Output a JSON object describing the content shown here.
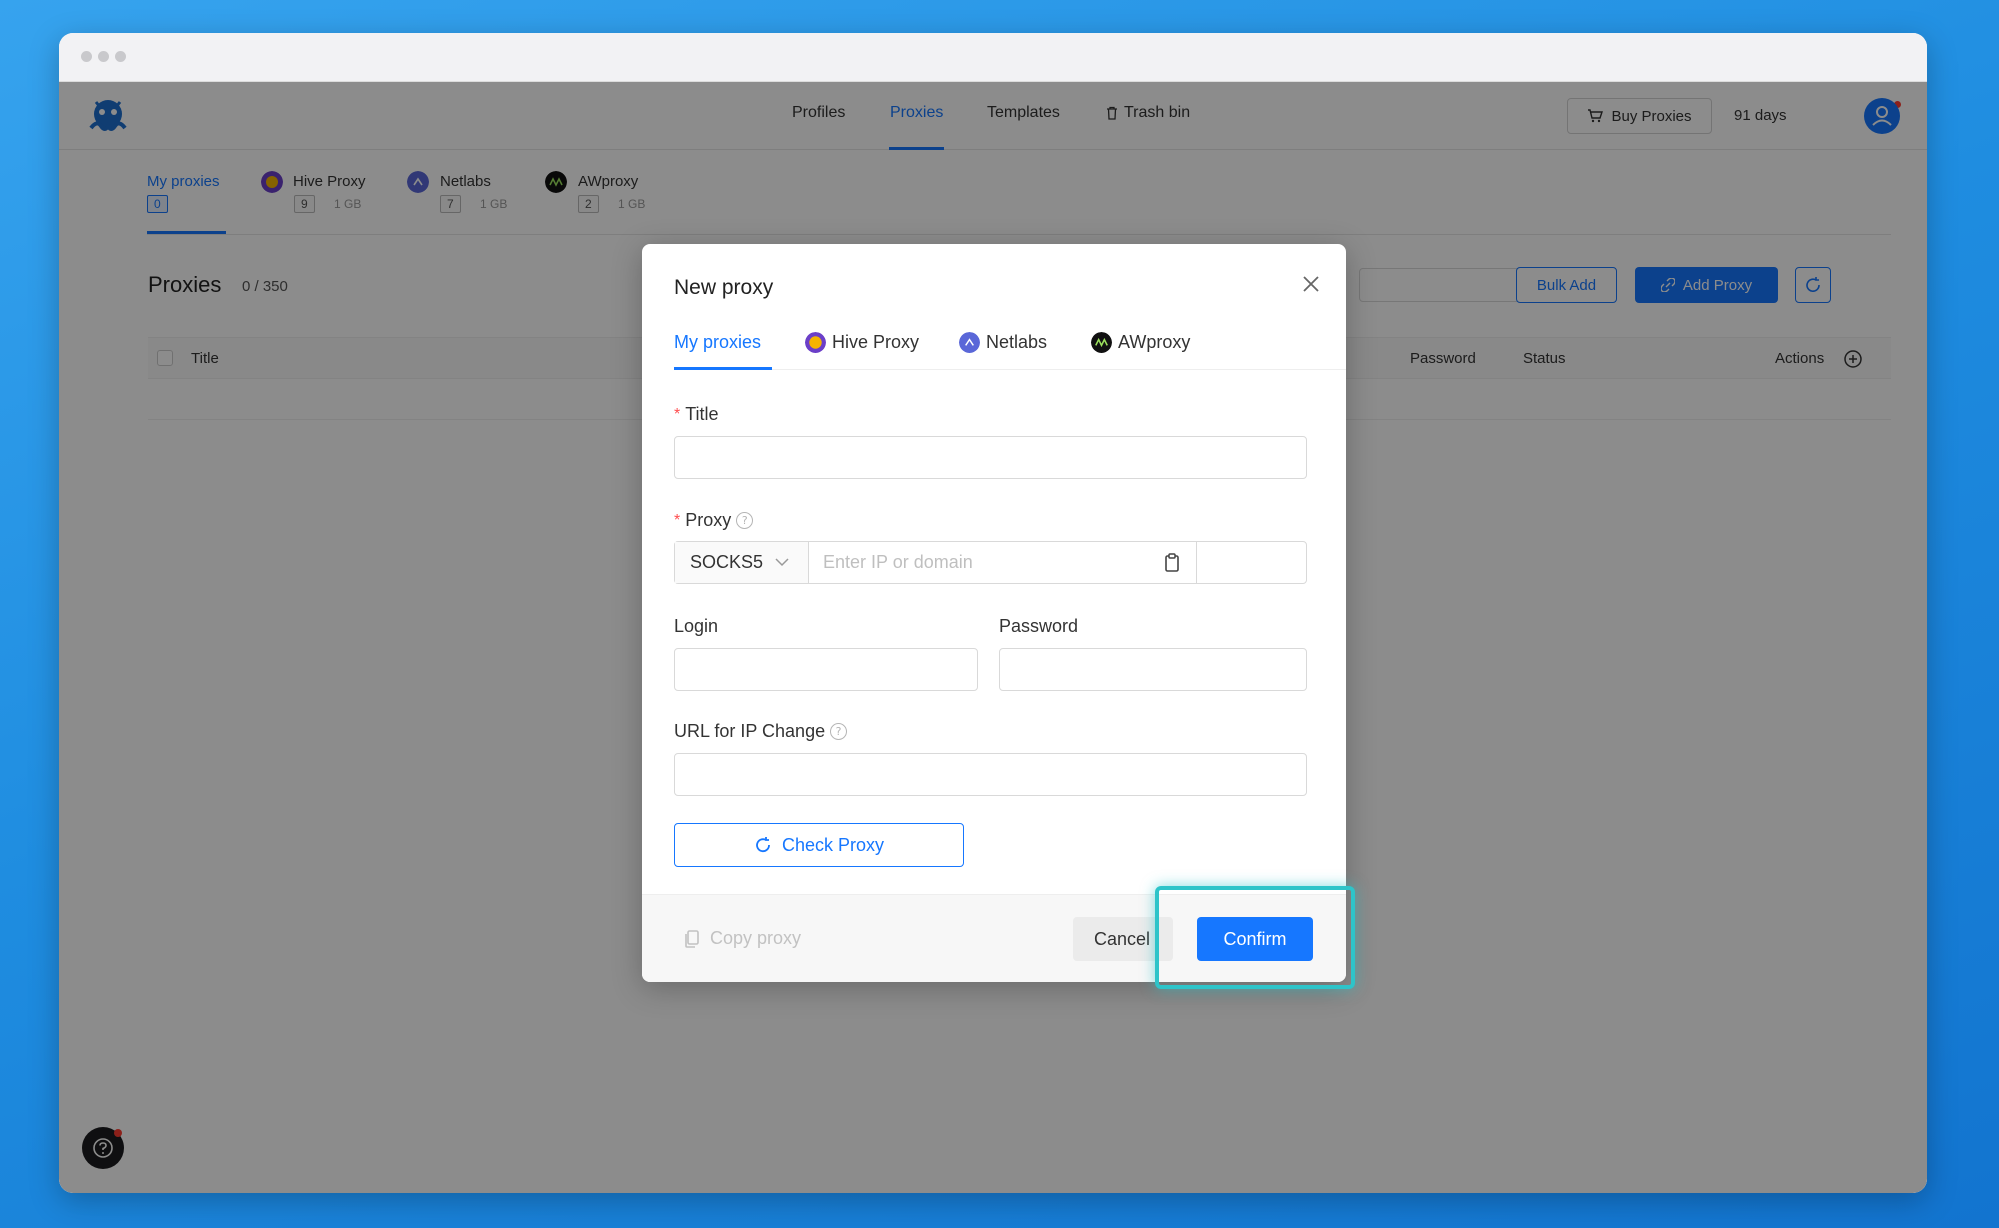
{
  "nav": {
    "items": [
      {
        "label": "Profiles"
      },
      {
        "label": "Proxies"
      },
      {
        "label": "Templates"
      },
      {
        "label": "Trash bin"
      }
    ],
    "active": "Proxies",
    "buy_proxies": "Buy Proxies",
    "days_left": "91 days"
  },
  "providers": [
    {
      "name": "My proxies",
      "count": "0",
      "size": ""
    },
    {
      "name": "Hive Proxy",
      "count": "9",
      "size": "1 GB"
    },
    {
      "name": "Netlabs",
      "count": "7",
      "size": "1 GB"
    },
    {
      "name": "AWproxy",
      "count": "2",
      "size": "1 GB"
    }
  ],
  "section": {
    "title": "Proxies",
    "count": "0 / 350",
    "bulk_add": "Bulk Add",
    "add_proxy": "Add Proxy"
  },
  "table": {
    "columns": [
      "Title",
      "Password",
      "Status",
      "Actions"
    ]
  },
  "modal": {
    "title": "New proxy",
    "tabs": [
      "My proxies",
      "Hive Proxy",
      "Netlabs",
      "AWproxy"
    ],
    "active_tab": "My proxies",
    "fields": {
      "title_label": "Title",
      "title_value": "",
      "proxy_label": "Proxy",
      "proxy_type": "SOCKS5",
      "host_placeholder": "Enter IP or domain",
      "host_value": "",
      "port_value": "",
      "login_label": "Login",
      "login_value": "",
      "password_label": "Password",
      "password_value": "",
      "url_label": "URL for IP Change",
      "url_value": ""
    },
    "check_proxy": "Check Proxy",
    "copy_proxy": "Copy proxy",
    "cancel": "Cancel",
    "confirm": "Confirm"
  },
  "colors": {
    "accent": "#1677ff",
    "highlight": "#2ec4c9",
    "required": "#ff4d4f",
    "hive": "#6b3fc8",
    "netlabs": "#5a67d8",
    "awproxy": "#111111"
  }
}
